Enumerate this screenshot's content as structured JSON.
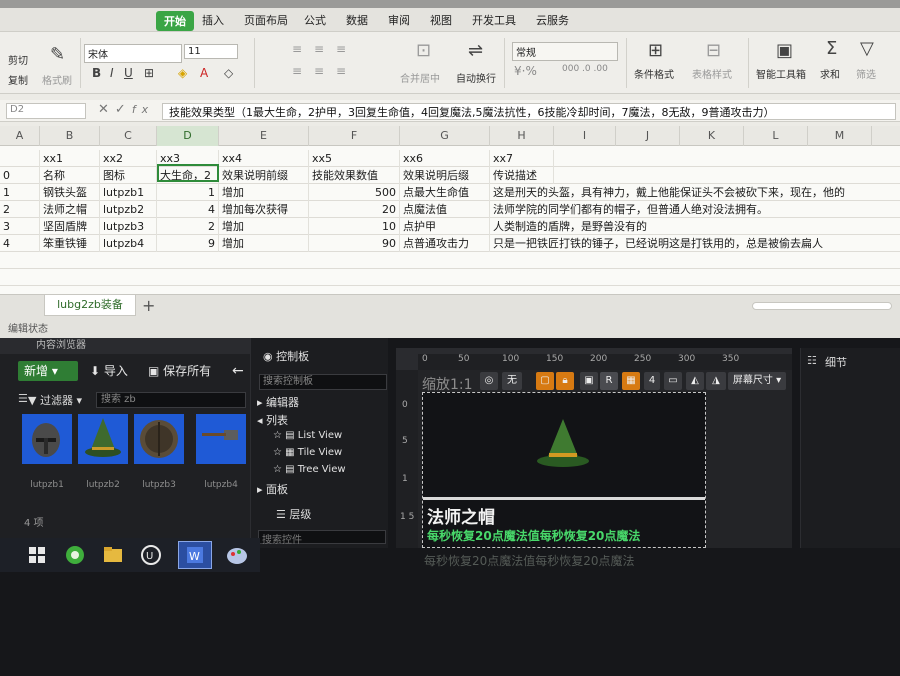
{
  "spreadsheet": {
    "menu": {
      "start": "开始",
      "items": [
        "插入",
        "页面布局",
        "公式",
        "数据",
        "审阅",
        "视图",
        "开发工具",
        "云服务"
      ]
    },
    "ribbon": {
      "cut": "剪切",
      "copy": "复制",
      "format_painter": "格式刷",
      "font_name": "宋体",
      "font_size": "11",
      "merge_center": "合并居中",
      "wrap_text": "自动换行",
      "number_format": "常规",
      "conditional_format": "条件格式",
      "table_style": "表格样式",
      "smart_toolbox": "智能工具箱",
      "sum": "求和",
      "filter": "筛选"
    },
    "formula_bar": {
      "cell_ref": "D2",
      "fx": "fx",
      "content": "技能效果类型（1最大生命，2护甲，3回复生命值，4回复魔法,5魔法抗性，6技能冷却时间，7魔法，8无敌，9普通攻击力）"
    },
    "columns": [
      "A",
      "B",
      "C",
      "D",
      "E",
      "F",
      "G",
      "H",
      "I",
      "J",
      "K",
      "L",
      "M"
    ],
    "rows": [
      {
        "a": "",
        "b": "xx1",
        "c": "xx2",
        "d": "xx3",
        "e": "xx4",
        "f": "xx5",
        "g": "xx6",
        "h": "xx7"
      },
      {
        "a": "0",
        "b": "名称",
        "c": "图标",
        "d": "大生命，2",
        "e": "效果说明前缀",
        "f": "技能效果数值",
        "g": "效果说明后缀",
        "h": "传说描述"
      },
      {
        "a": "1",
        "b": "钢铁头盔",
        "c": "lutpzb1",
        "d": "1",
        "e": "增加",
        "f": "500",
        "g": "点最大生命值",
        "h": "这是刑天的头盔，具有神力，戴上他能保证头不会被砍下来，现在，他的"
      },
      {
        "a": "2",
        "b": "法师之帽",
        "c": "lutpzb2",
        "d": "4",
        "e": "增加每次获得",
        "f": "20",
        "g": "点魔法值",
        "h": "法师学院的同学们都有的帽子，但普通人绝对没法拥有。"
      },
      {
        "a": "3",
        "b": "坚固盾牌",
        "c": "lutpzb3",
        "d": "2",
        "e": "增加",
        "f": "10",
        "g": "点护甲",
        "h": "人类制造的盾牌，是野兽没有的"
      },
      {
        "a": "4",
        "b": "笨重铁锤",
        "c": "lutpzb4",
        "d": "9",
        "e": "增加",
        "f": "90",
        "g": "点普通攻击力",
        "h": "只是一把铁匠打铁的锤子，已经说明这是打铁用的，总是被偷去扁人"
      }
    ],
    "sheet_tab": "lubg2zb装备",
    "add_tab": "+",
    "status": "编辑状态"
  },
  "unreal": {
    "content_browser": {
      "tab": "内容浏览器",
      "new_button": "新增",
      "import_button": "导入",
      "save_all_button": "保存所有",
      "filter_button": "过滤器",
      "search_placeholder": "搜索 zb",
      "assets": [
        "lutpzb1",
        "lutpzb2",
        "lutpzb3",
        "lutpzb4"
      ],
      "count": "4 项"
    },
    "palette": {
      "title": "控制板",
      "search_placeholder": "搜索控制板",
      "categories": [
        "编辑器",
        "列表"
      ],
      "list_items": [
        "List View",
        "Tile View",
        "Tree View"
      ],
      "panel_category": "面板",
      "layers_title": "层级",
      "layers_search": "搜索控件"
    },
    "designer": {
      "zoom": "缩放1:1",
      "ruler_ticks": [
        "0",
        "50",
        "100",
        "150",
        "200",
        "250",
        "300",
        "350"
      ],
      "left_ticks": [
        "0",
        "5",
        "1",
        "1 5"
      ],
      "buttons": [
        "无",
        "R",
        "4"
      ],
      "screen_size": "屏幕尺寸",
      "item_name": "法师之帽",
      "item_desc": "每秒恢复20点魔法值每秒恢复20点魔法",
      "item_desc_ghost": "每秒恢复20点魔法值每秒恢复20点魔法"
    },
    "details": {
      "title": "细节"
    }
  },
  "colors": {
    "accent_green": "#3aa545",
    "ue_new_green": "#2f7d34",
    "desc_green": "#48d86a",
    "thumb_blue": "#1f5ad6"
  }
}
